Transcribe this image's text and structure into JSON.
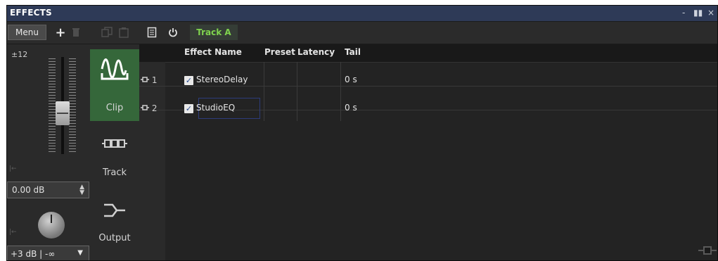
{
  "window": {
    "title": "EFFECTS",
    "controls": [
      "-",
      "▮▮",
      "×"
    ]
  },
  "toolbar": {
    "menu_label": "Menu",
    "track_tab_label": "Track A",
    "icons": [
      "add-icon",
      "delete-icon",
      "copy-icon",
      "paste-icon",
      "list-icon",
      "power-icon"
    ]
  },
  "left_panel": {
    "range_label": "±12",
    "gain_value": "0.00 dB",
    "meter_range": "+3 dB | -∞",
    "fader_level": 0.5
  },
  "tabs": [
    {
      "label": "Clip",
      "icon": "clip-waveform-icon",
      "active": true
    },
    {
      "label": "Track",
      "icon": "track-chain-icon",
      "active": false
    },
    {
      "label": "Output",
      "icon": "output-route-icon",
      "active": false
    }
  ],
  "effects_table": {
    "columns": [
      "Effect Name",
      "Preset",
      "Latency",
      "Tail"
    ],
    "rows": [
      {
        "slot": "1",
        "enabled": true,
        "name": "StereoDelay",
        "preset": "",
        "latency": "",
        "tail": "0 s"
      },
      {
        "slot": "2",
        "enabled": true,
        "name": "StudioEQ",
        "preset": "",
        "latency": "",
        "tail": "0 s"
      }
    ]
  },
  "colors": {
    "accent_green": "#7fd34e",
    "titlebar": "#2e3a57",
    "active_tab": "#35673a",
    "background": "#1b1b1b"
  }
}
